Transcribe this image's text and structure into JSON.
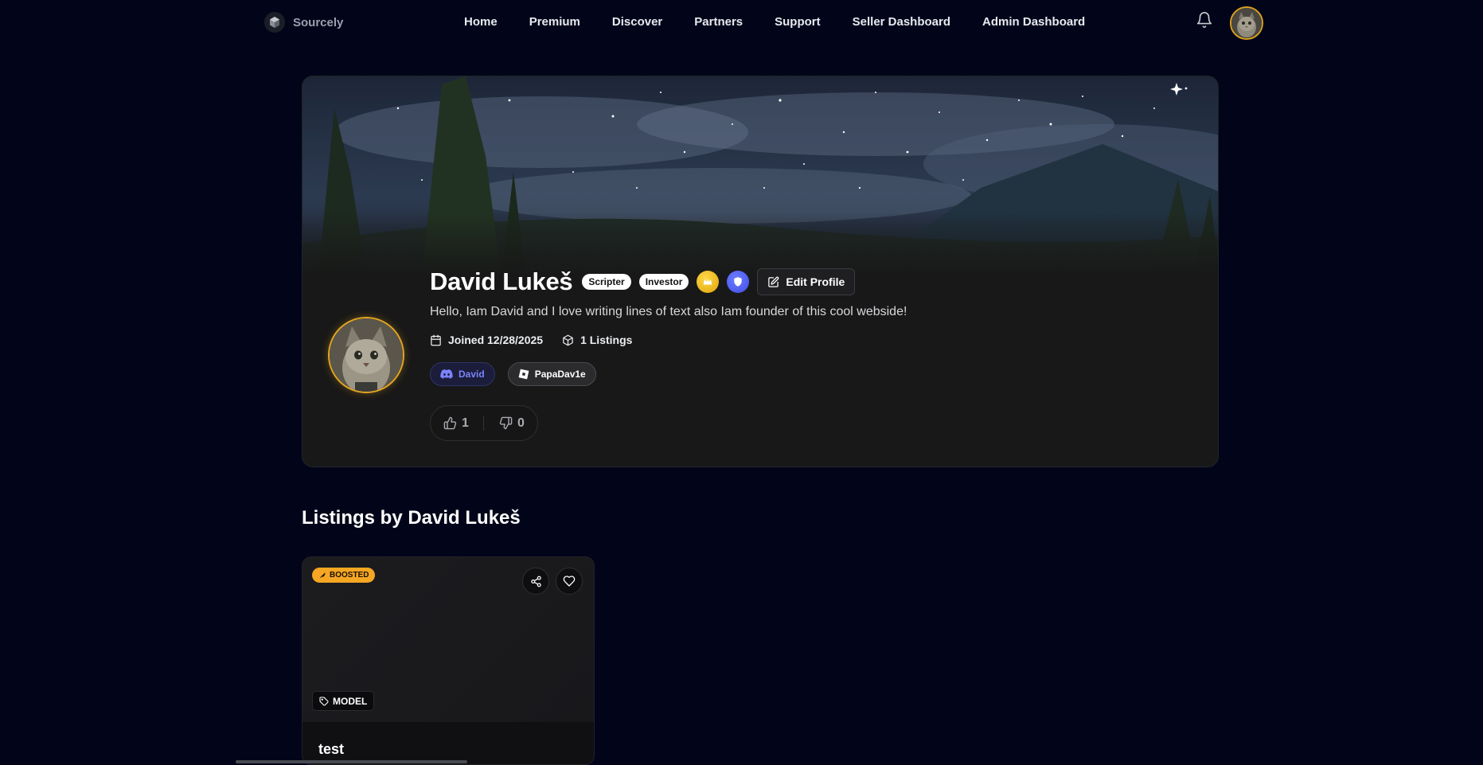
{
  "nav": {
    "brand": "Sourcely",
    "links": [
      "Home",
      "Premium",
      "Discover",
      "Partners",
      "Support",
      "Seller Dashboard",
      "Admin Dashboard"
    ]
  },
  "profile": {
    "name": "David Lukeš",
    "tags": [
      "Scripter",
      "Investor"
    ],
    "edit_label": "Edit Profile",
    "bio": "Hello, Iam David and I love writing lines of text also Iam founder of this cool webside!",
    "joined": "Joined 12/28/2025",
    "listings_count": "1 Listings",
    "discord": "David",
    "roblox": "PapaDav1e",
    "likes": "1",
    "dislikes": "0"
  },
  "listings": {
    "title": "Listings by David Lukeš",
    "items": [
      {
        "badge": "BOOSTED",
        "category": "MODEL",
        "title": "test"
      }
    ]
  },
  "colors": {
    "background": "#02051a",
    "card": "#181818",
    "accent_gold": "#e3a521",
    "discord": "#7b84ff",
    "boost": "#f5a623"
  }
}
